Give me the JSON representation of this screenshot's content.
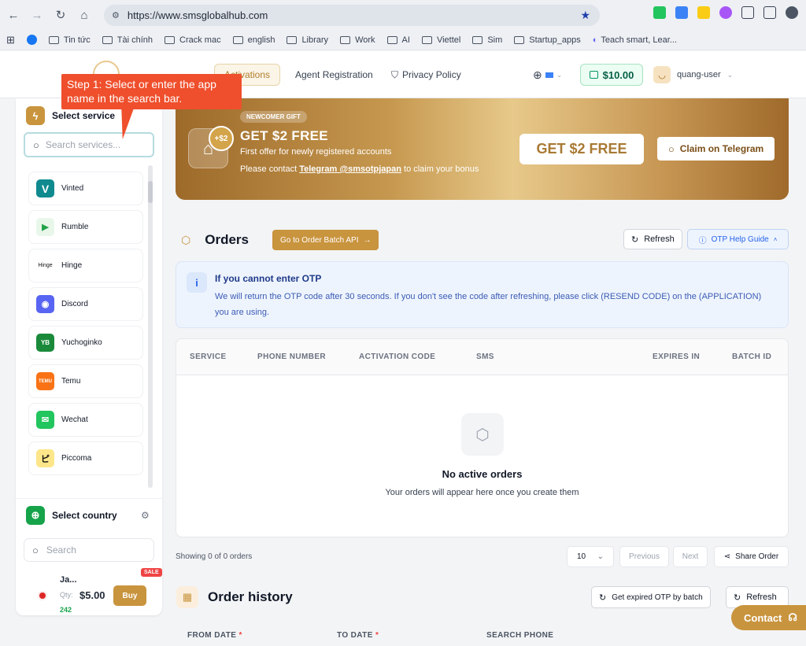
{
  "browser": {
    "url": "https://www.smsglobalhub.com",
    "bookmarks": [
      "Tin tức",
      "Tài chính",
      "Crack mac",
      "english",
      "Library",
      "Work",
      "AI",
      "Viettel",
      "Sim",
      "Startup_apps",
      "Teach smart, Lear..."
    ]
  },
  "header": {
    "tabs": [
      "Activations",
      "Agent Registration",
      "Privacy Policy"
    ],
    "balance": "$10.00",
    "username": "quang-user"
  },
  "callout": {
    "text": "Step 1: Select or enter the app name in the search bar."
  },
  "sidebar": {
    "service_title": "Select service",
    "service_placeholder": "Search services...",
    "services": [
      {
        "name": "Vinted",
        "logo": "V",
        "color": "#0f8a8f"
      },
      {
        "name": "Rumble",
        "logo": "▶",
        "color": "#e8f7ea"
      },
      {
        "name": "Hinge",
        "logo": "Hinge",
        "color": "#ffffff"
      },
      {
        "name": "Discord",
        "logo": "◉",
        "color": "#5865f2"
      },
      {
        "name": "Yuchoginko",
        "logo": "YB",
        "color": "#1a8a3a"
      },
      {
        "name": "Temu",
        "logo": "TEMU",
        "color": "#f97316"
      },
      {
        "name": "Wechat",
        "logo": "✉",
        "color": "#22c55e"
      },
      {
        "name": "Piccoma",
        "logo": "ピ",
        "color": "#fde68a"
      }
    ],
    "country_title": "Select country",
    "country_placeholder": "Search",
    "country": {
      "name": "Ja...",
      "qty_label": "Qty:",
      "qty": "242",
      "price": "$5.00",
      "buy": "Buy",
      "sale": "SALE"
    }
  },
  "banner": {
    "badge": "NEWCOMER GIFT",
    "gift_amount": "+$2",
    "title": "GET $2 FREE",
    "subtitle": "First offer for newly registered accounts",
    "contact_prefix": "Please contact ",
    "contact_link": "Telegram @smsotpjapan",
    "contact_suffix": " to claim your bonus",
    "big_text": "GET $2 FREE",
    "claim": "Claim on Telegram"
  },
  "orders": {
    "title": "Orders",
    "api_button": "Go to Order Batch API",
    "refresh": "Refresh",
    "help": "OTP Help Guide",
    "info_title": "If you cannot enter OTP",
    "info_text": "We will return the OTP code after 30 seconds. If you don't see the code after refreshing, please click (RESEND CODE) on the (APPLICATION) you are using.",
    "columns": [
      "SERVICE",
      "PHONE NUMBER",
      "ACTIVATION CODE",
      "SMS",
      "EXPIRES IN",
      "BATCH ID"
    ],
    "empty_title": "No active orders",
    "empty_sub": "Your orders will appear here once you create them",
    "showing": "Showing 0 of 0 orders",
    "page_size": "10",
    "previous": "Previous",
    "next": "Next",
    "share": "Share Order"
  },
  "history": {
    "title": "Order history",
    "expired_btn": "Get expired OTP by batch",
    "refresh": "Refresh",
    "from_date": "FROM DATE",
    "to_date": "TO DATE",
    "search_phone": "SEARCH PHONE"
  },
  "contact": "Contact"
}
